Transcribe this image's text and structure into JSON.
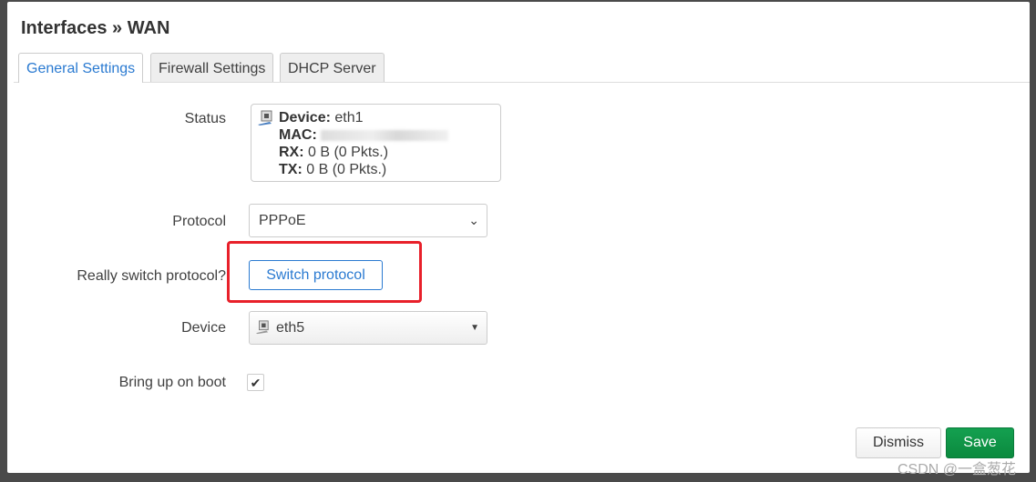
{
  "modal": {
    "title": "Interfaces » WAN",
    "tabs": [
      {
        "label": "General Settings",
        "active": true
      },
      {
        "label": "Firewall Settings",
        "active": false
      },
      {
        "label": "DHCP Server",
        "active": false
      }
    ],
    "status": {
      "label": "Status",
      "device_key": "Device:",
      "device_val": "eth1",
      "mac_key": "MAC:",
      "rx_key": "RX:",
      "rx_val": "0 B (0 Pkts.)",
      "tx_key": "TX:",
      "tx_val": "0 B (0 Pkts.)"
    },
    "protocol": {
      "label": "Protocol",
      "value": "PPPoE"
    },
    "switch": {
      "label": "Really switch protocol?",
      "button": "Switch protocol"
    },
    "device": {
      "label": "Device",
      "value": "eth5"
    },
    "boot": {
      "label": "Bring up on boot",
      "checked": true,
      "mark": "✔"
    },
    "footer": {
      "dismiss": "Dismiss",
      "save": "Save"
    },
    "watermark": "CSDN @一盒葱花",
    "colors": {
      "accent": "#2a7ad1",
      "save": "#0b8a3e",
      "highlight": "#e8202a"
    }
  }
}
